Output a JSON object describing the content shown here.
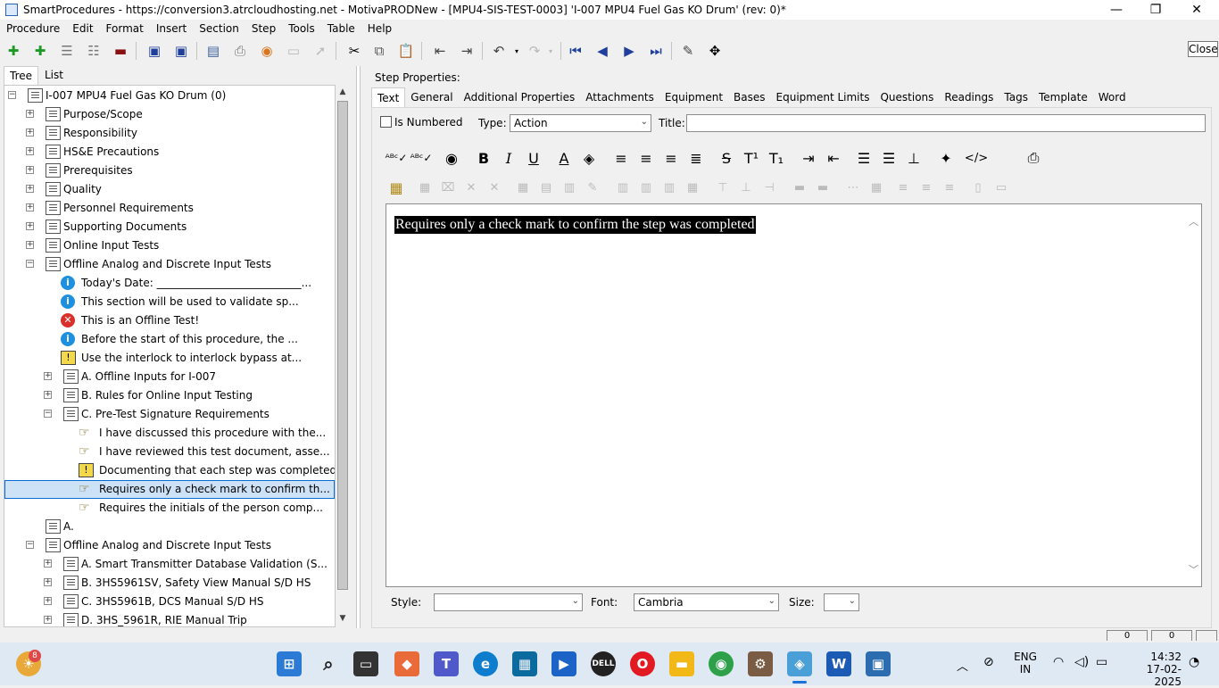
{
  "window": {
    "title": "SmartProcedures - https://conversion3.atrcloudhosting.net - MotivaPRODNew - [MPU4-SIS-TEST-0003] 'I-007 MPU4 Fuel Gas KO Drum' (rev: 0)*",
    "minimize": "—",
    "maximize": "❐",
    "close": "✕"
  },
  "menu": [
    "Procedure",
    "Edit",
    "Format",
    "Insert",
    "Section",
    "Step",
    "Tools",
    "Table",
    "Help"
  ],
  "tooltip_close": "Close",
  "left_tabs": {
    "tree": "Tree",
    "list": "List"
  },
  "tree": [
    {
      "label": "I-007 MPU4 Fuel Gas KO Drum (0)",
      "expander": "−",
      "icon": "doc"
    },
    {
      "label": "Purpose/Scope",
      "expander": "+",
      "icon": "doc"
    },
    {
      "label": "Responsibility",
      "expander": "+",
      "icon": "doc"
    },
    {
      "label": "HS&E Precautions",
      "expander": "+",
      "icon": "doc"
    },
    {
      "label": "Prerequisites",
      "expander": "+",
      "icon": "doc"
    },
    {
      "label": "Quality",
      "expander": "+",
      "icon": "doc"
    },
    {
      "label": "Personnel Requirements",
      "expander": "+",
      "icon": "doc"
    },
    {
      "label": "Supporting Documents",
      "expander": "+",
      "icon": "doc"
    },
    {
      "label": "Online Input Tests",
      "expander": "+",
      "icon": "doc"
    },
    {
      "label": "Offline Analog and Discrete Input Tests",
      "expander": "−",
      "icon": "doc"
    },
    {
      "label": "Today's Date: ___________________________...",
      "icon": "info"
    },
    {
      "label": "This section will be used to validate sp...",
      "icon": "info"
    },
    {
      "label": "This is an Offline Test!",
      "icon": "error"
    },
    {
      "label": "Before the start of this procedure, the ...",
      "icon": "info"
    },
    {
      "label": "Use the interlock to interlock bypass at...",
      "icon": "warn"
    },
    {
      "label": "A. Offline Inputs for I-007",
      "expander": "+",
      "icon": "doc"
    },
    {
      "label": "B. Rules for Online Input Testing",
      "expander": "+",
      "icon": "doc"
    },
    {
      "label": "C. Pre-Test Signature Requirements",
      "expander": "−",
      "icon": "doc"
    },
    {
      "label": "I have discussed this procedure with the...",
      "icon": "hand"
    },
    {
      "label": "I have reviewed this test document, asse...",
      "icon": "hand"
    },
    {
      "label": "Documenting that each step was completed...",
      "icon": "warn"
    },
    {
      "label": "Requires only a check mark to confirm th...",
      "icon": "hand"
    },
    {
      "label": "Requires the initials of the person comp...",
      "icon": "hand"
    },
    {
      "label": "A.",
      "icon": "doc"
    },
    {
      "label": "Offline Analog and Discrete Input Tests",
      "expander": "−",
      "icon": "doc"
    },
    {
      "label": "A. Smart Transmitter Database Validation (S...",
      "expander": "+",
      "icon": "doc"
    },
    {
      "label": "B. 3HS5961SV, Safety View Manual S/D HS",
      "expander": "+",
      "icon": "doc"
    },
    {
      "label": "C. 3HS5961B, DCS Manual S/D HS",
      "expander": "+",
      "icon": "doc"
    },
    {
      "label": "D. 3HS_5961R, RIE Manual Trip",
      "expander": "+",
      "icon": "doc"
    }
  ],
  "step_properties": {
    "heading": "Step Properties:",
    "tabs": [
      "Text",
      "General",
      "Additional Properties",
      "Attachments",
      "Equipment",
      "Bases",
      "Equipment Limits",
      "Questions",
      "Readings",
      "Tags",
      "Template",
      "Word"
    ],
    "is_numbered_label": "Is Numbered",
    "type_label": "Type:",
    "type_value": "Action",
    "title_label": "Title:",
    "title_value": "",
    "editor_text": "Requires only a check mark to confirm the step was completed",
    "style_label": "Style:",
    "style_value": "",
    "font_label": "Font:",
    "font_value": "Cambria",
    "size_label": "Size:",
    "size_value": ""
  },
  "status_boxes": [
    "0",
    "0"
  ],
  "taskbar": {
    "notification_badge": "8",
    "lang_line1": "ENG",
    "lang_line2": "IN",
    "time": "14:32",
    "date": "17-02-2025"
  }
}
